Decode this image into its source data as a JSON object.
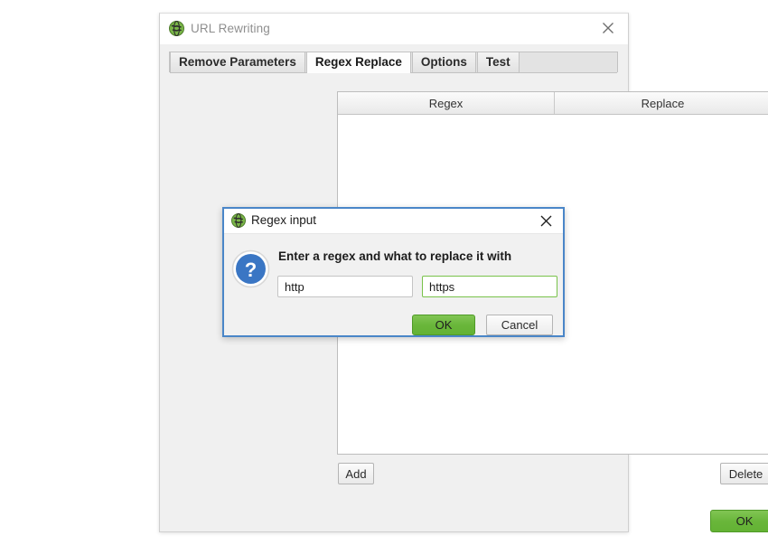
{
  "window": {
    "title": "URL Rewriting",
    "icon": "app-globe-icon",
    "close_label": "close-icon"
  },
  "tabs": [
    {
      "label": "Remove Parameters",
      "selected": false
    },
    {
      "label": "Regex Replace",
      "selected": true
    },
    {
      "label": "Options",
      "selected": false
    },
    {
      "label": "Test",
      "selected": false
    }
  ],
  "table": {
    "columns": [
      "Regex",
      "Replace"
    ],
    "rows": []
  },
  "buttons": {
    "add": "Add",
    "delete": "Delete",
    "ok": "OK"
  },
  "dialog": {
    "title": "Regex input",
    "icon": "app-globe-icon",
    "close_label": "close-icon",
    "prompt": "Enter a regex and what to replace it with",
    "icon_glyph": "?",
    "fields": {
      "regex": {
        "value": "http",
        "placeholder": "",
        "focused": false
      },
      "replace": {
        "value": "https",
        "placeholder": "",
        "focused": true
      }
    },
    "ok_label": "OK",
    "cancel_label": "Cancel"
  },
  "colors": {
    "accent_green": "#69b63a",
    "dialog_border_blue": "#4a86c8",
    "question_blue": "#3a76c4",
    "focus_green": "#79c24a",
    "window_bg": "#f0f0f0"
  }
}
